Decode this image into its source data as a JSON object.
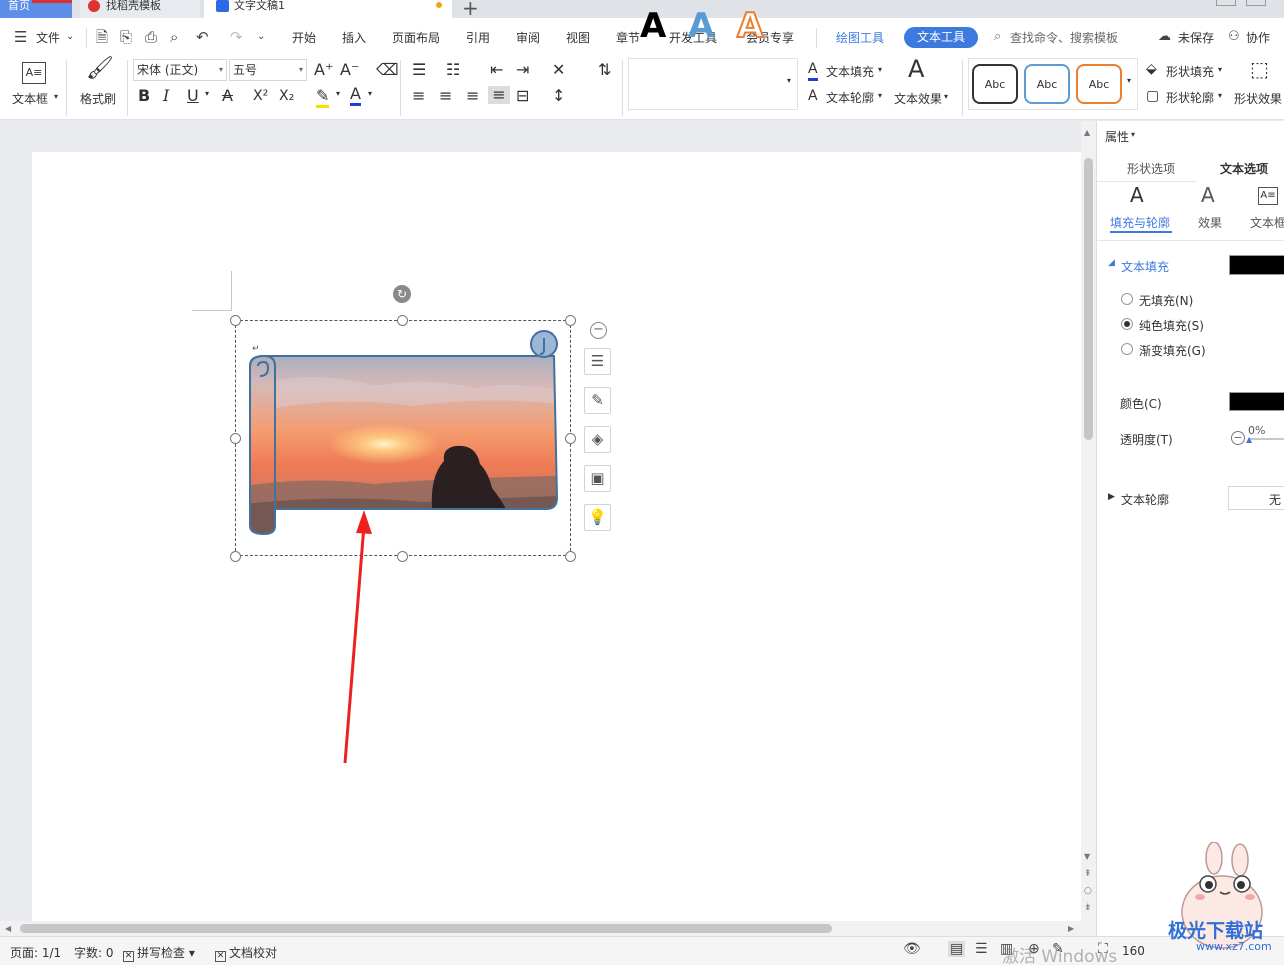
{
  "tabs": {
    "home": "首页",
    "template": "找稻壳模板",
    "doc": "文字文稿1",
    "plus": "+"
  },
  "menu": {
    "file": "文件",
    "items": [
      "开始",
      "插入",
      "页面布局",
      "引用",
      "审阅",
      "视图",
      "章节",
      "开发工具",
      "会员专享"
    ],
    "draw_tools": "绘图工具",
    "text_tools": "文本工具",
    "search": "查找命令、搜索模板",
    "unsaved": "未保存",
    "collab": "协作"
  },
  "ribbon": {
    "textbox": "文本框",
    "format_painter": "格式刷",
    "font_name": "宋体 (正文)",
    "font_size": "五号",
    "text_fill": "文本填充",
    "text_outline": "文本轮廓",
    "text_effect": "文本效果",
    "shape_fill": "形状填充",
    "shape_outline": "形状轮廓",
    "shape_effect": "形状效果",
    "style_abc": "Abc",
    "big_a": "A",
    "font_increase": "A⁺",
    "font_decrease": "A⁻",
    "bold": "B",
    "italic": "I",
    "underline": "U",
    "strike": "A",
    "superscript": "X²",
    "subscript": "X₂",
    "highlight": "✎",
    "font_color": "A"
  },
  "panel": {
    "properties": "属性",
    "tab_shape": "形状选项",
    "tab_text": "文本选项",
    "sub_fill": "填充与轮廓",
    "sub_effect": "效果",
    "sub_textbox": "文本框",
    "text_fill": "文本填充",
    "no_fill": "无填充(N)",
    "solid_fill": "纯色填充(S)",
    "gradient_fill": "渐变填充(G)",
    "color": "颜色(C)",
    "transparency": "透明度(T)",
    "transparency_value": "0%",
    "text_outline": "文本轮廓",
    "outline_value": "无",
    "fill_color": "#000000"
  },
  "status": {
    "page": "页面: 1/1",
    "words": "字数: 0",
    "spell": "拼写检查",
    "proof": "文档校对",
    "zoom": "160"
  },
  "watermark": {
    "windows": "激活 Windows",
    "site": "极光下载站",
    "url": "www.xz7.com"
  }
}
